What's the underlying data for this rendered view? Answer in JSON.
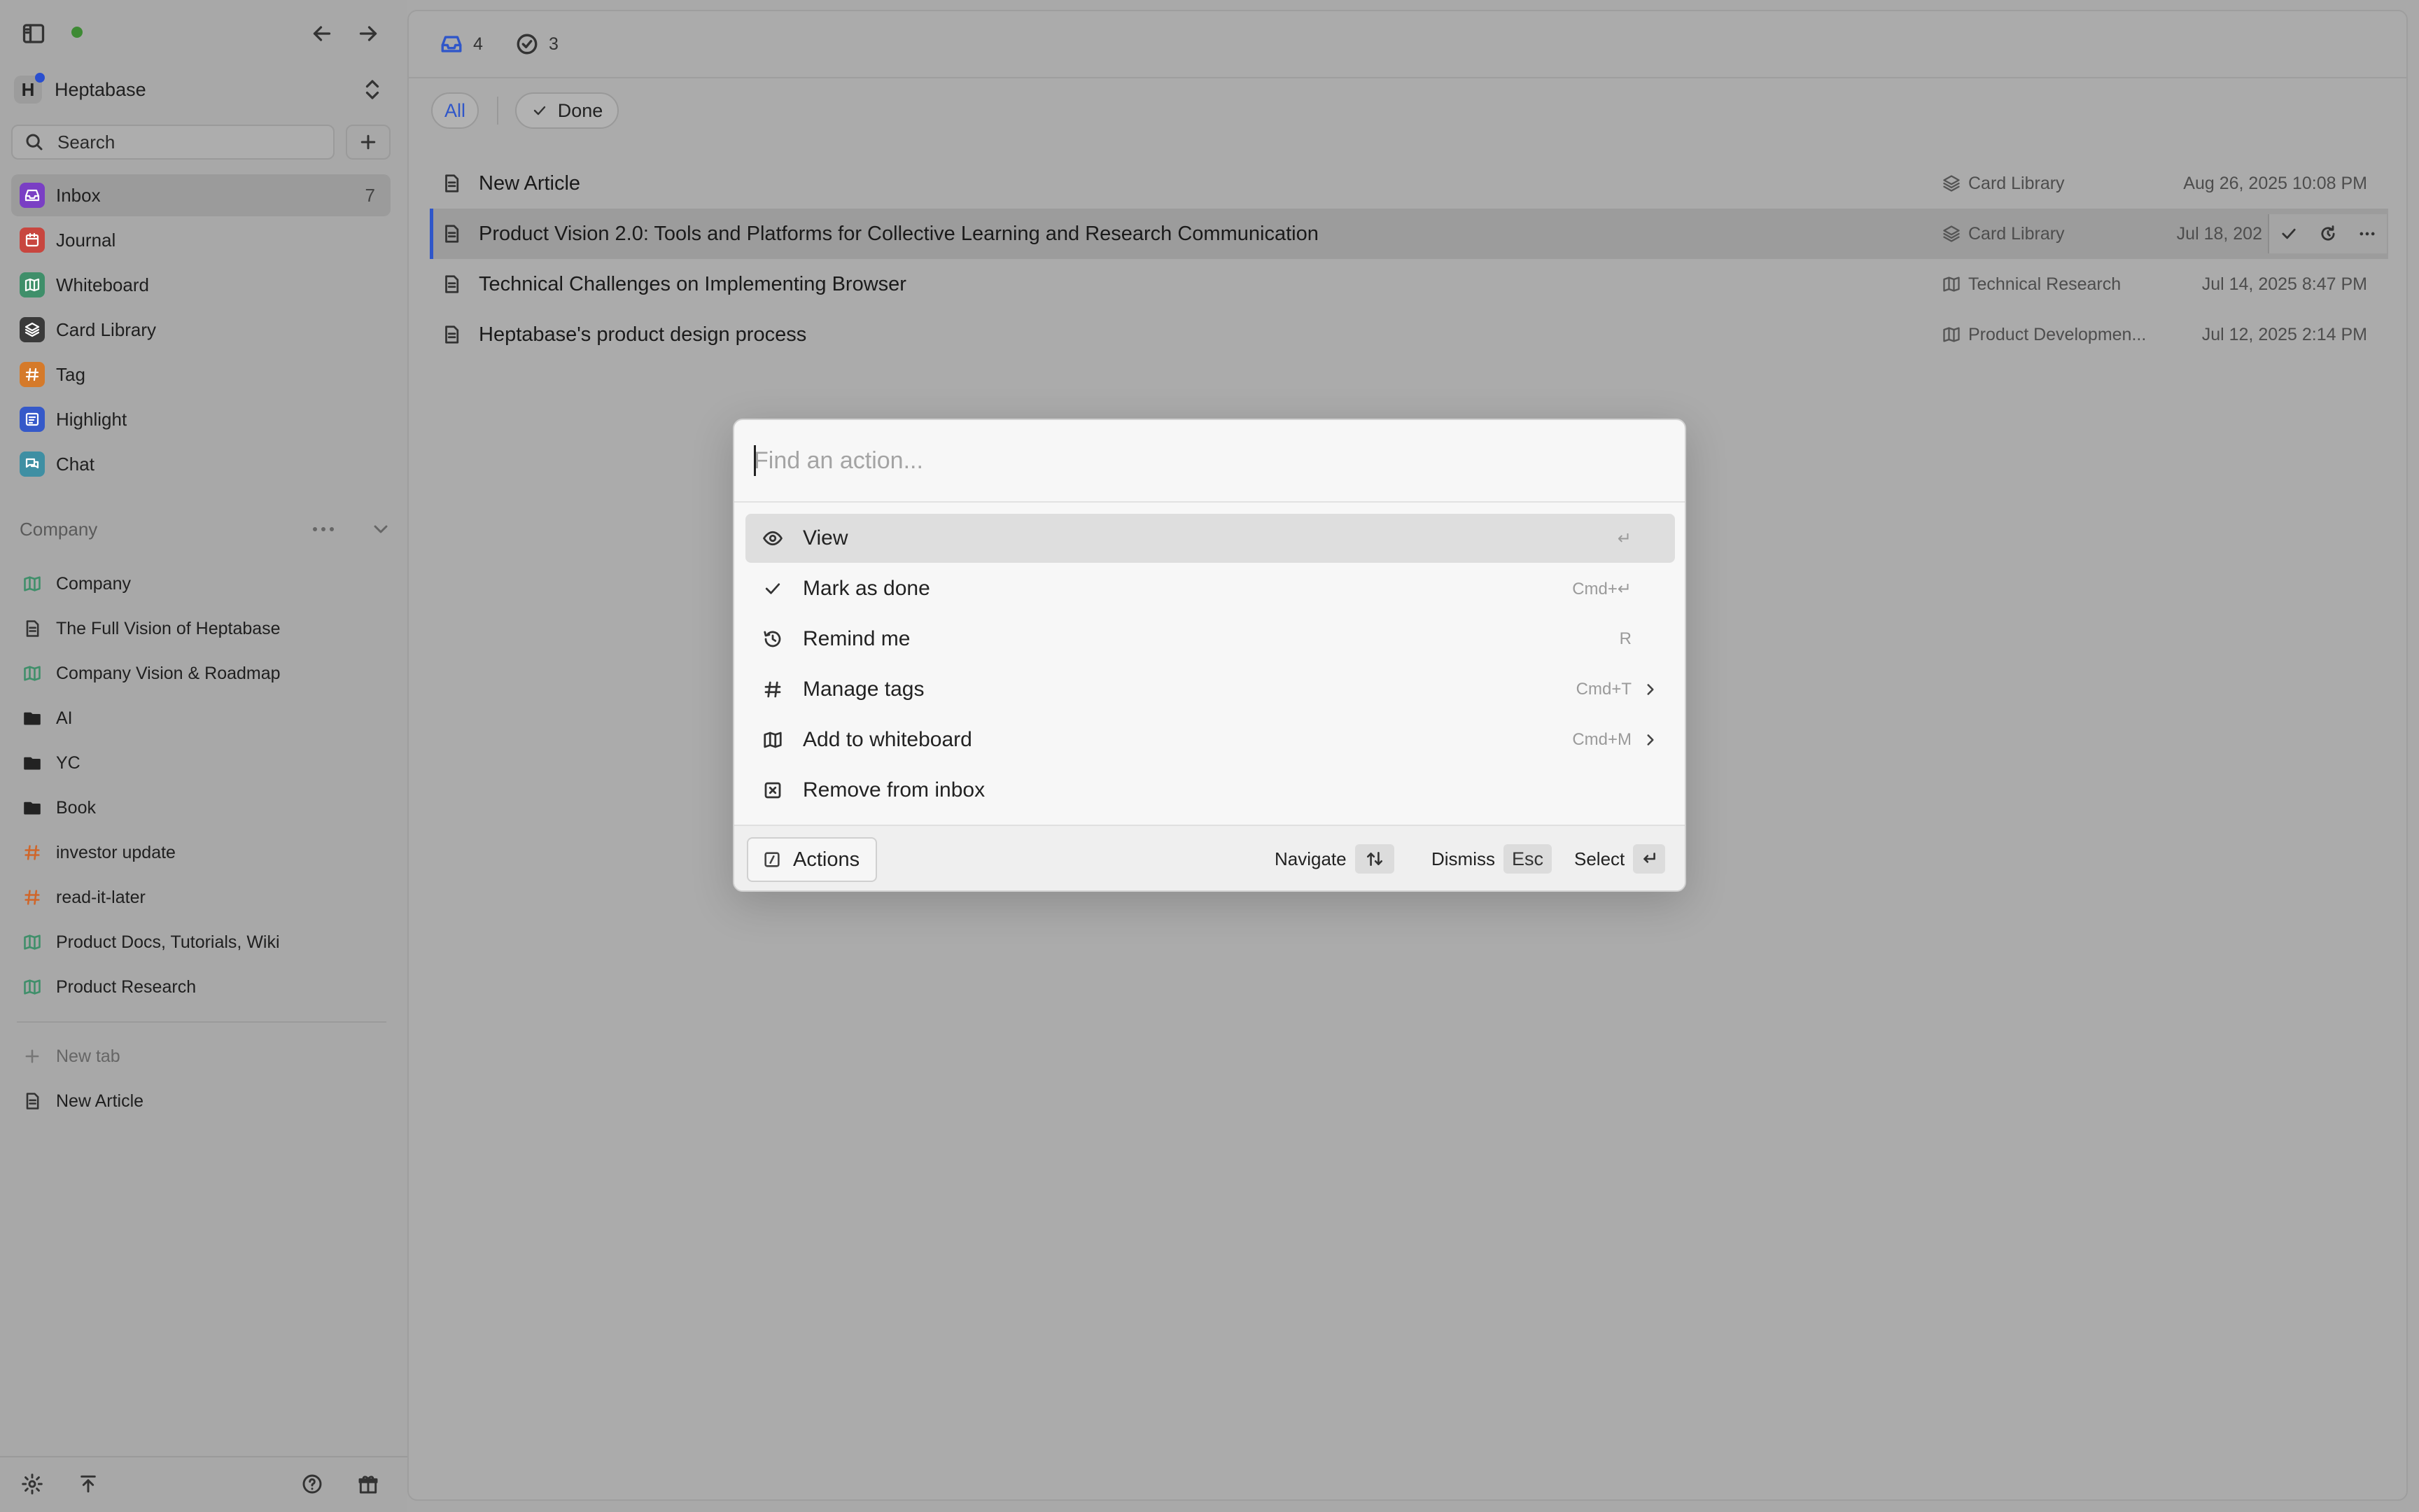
{
  "sidebar": {
    "workspace": {
      "initial": "H",
      "name": "Heptabase"
    },
    "search_label": "Search",
    "nav": [
      {
        "label": "Inbox",
        "count": "7",
        "color": "#7a3fc4"
      },
      {
        "label": "Journal",
        "color": "#c8463f"
      },
      {
        "label": "Whiteboard",
        "color": "#3f8f6a"
      },
      {
        "label": "Card Library",
        "color": "#3a3a3a"
      },
      {
        "label": "Tag",
        "color": "#d57a2a"
      },
      {
        "label": "Highlight",
        "color": "#3559c9"
      },
      {
        "label": "Chat",
        "color": "#3f8fa3"
      }
    ],
    "section_title": "Company",
    "tree": [
      {
        "label": "Company",
        "icon": "whiteboard-icon"
      },
      {
        "label": "The Full Vision of Heptabase",
        "icon": "document-icon"
      },
      {
        "label": "Company Vision & Roadmap",
        "icon": "whiteboard-icon"
      },
      {
        "label": "AI",
        "icon": "folder-icon"
      },
      {
        "label": "YC",
        "icon": "folder-icon"
      },
      {
        "label": "Book",
        "icon": "folder-icon"
      },
      {
        "label": "investor update",
        "icon": "hash-icon"
      },
      {
        "label": "read-it-later",
        "icon": "hash-icon"
      },
      {
        "label": "Product Docs, Tutorials, Wiki",
        "icon": "whiteboard-icon"
      },
      {
        "label": "Product Research",
        "icon": "whiteboard-icon"
      }
    ],
    "new_tab_label": "New tab",
    "open_tab_label": "New Article"
  },
  "main": {
    "inbox_count": "4",
    "done_count": "3",
    "filters": {
      "all": "All",
      "done": "Done"
    },
    "rows": [
      {
        "title": "New Article",
        "location": "Card Library",
        "date": "Aug 26, 2025 10:08 PM"
      },
      {
        "title": "Product Vision 2.0: Tools and Platforms for Collective Learning and Research Communication",
        "location": "Card Library",
        "date": "Jul 18, 202"
      },
      {
        "title": "Technical Challenges on Implementing Browser",
        "location": "Technical Research",
        "date": "Jul 14, 2025 8:47 PM"
      },
      {
        "title": "Heptabase's product design process",
        "location": "Product Developmen...",
        "date": "Jul 12, 2025 2:14 PM"
      }
    ]
  },
  "palette": {
    "placeholder": "Find an action...",
    "items": [
      {
        "label": "View",
        "shortcut": "↵"
      },
      {
        "label": "Mark as done",
        "shortcut": "Cmd+↵"
      },
      {
        "label": "Remind me",
        "shortcut": "R"
      },
      {
        "label": "Manage tags",
        "shortcut": "Cmd+T"
      },
      {
        "label": "Add to whiteboard",
        "shortcut": "Cmd+M"
      },
      {
        "label": "Remove from inbox",
        "shortcut": ""
      }
    ],
    "footer": {
      "actions_label": "Actions",
      "navigate_label": "Navigate",
      "dismiss_label": "Dismiss",
      "dismiss_key": "Esc",
      "select_label": "Select"
    }
  },
  "colors": {
    "accent": "#2f56c9",
    "status_online": "#3e8a34"
  }
}
